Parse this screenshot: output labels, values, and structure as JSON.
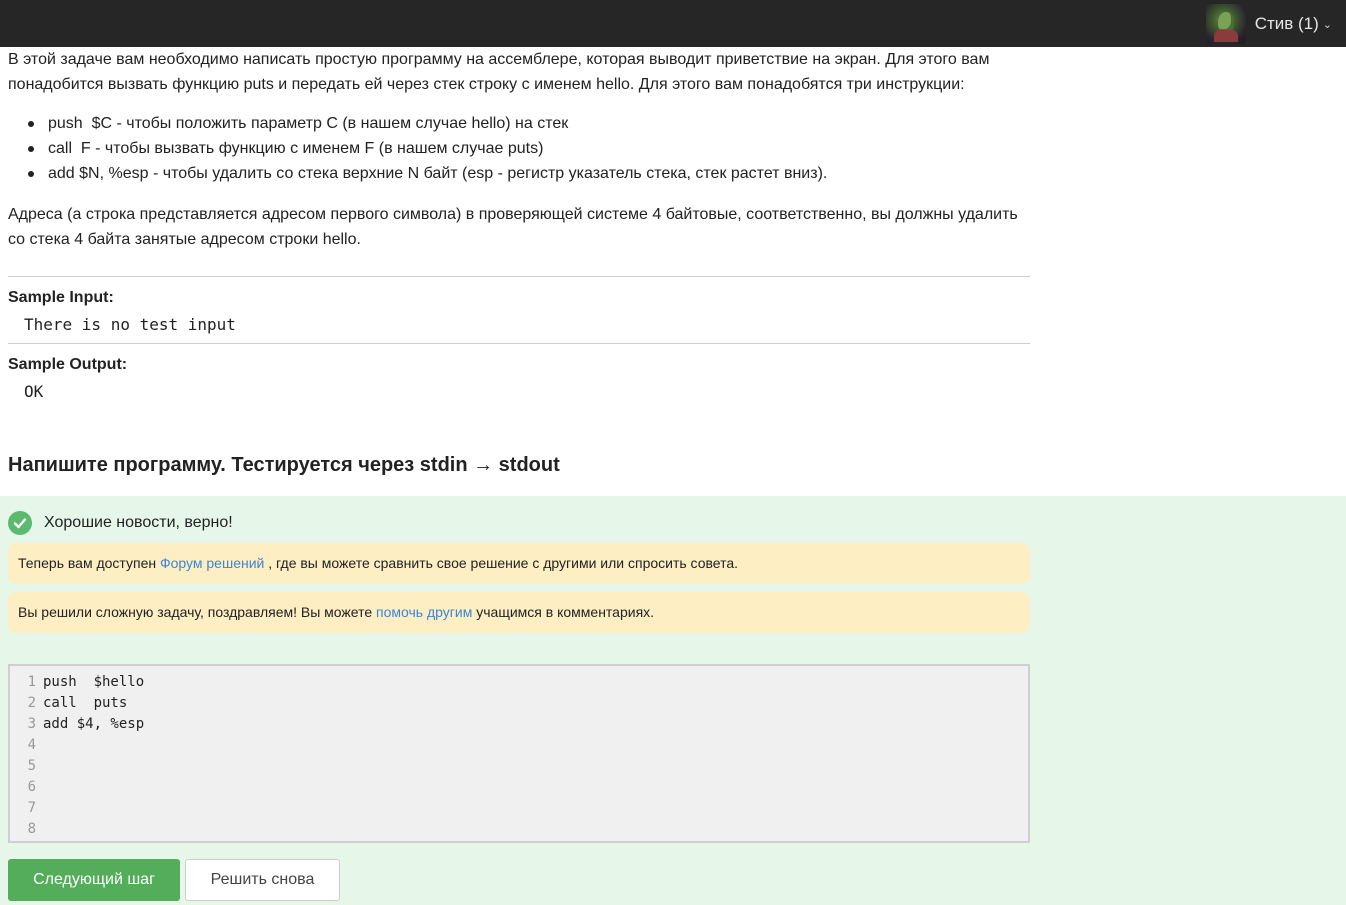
{
  "header": {
    "user_name": "Стив (1)",
    "chevron": "⌄"
  },
  "problem": {
    "intro": "В этой задаче вам необходимо написать простую программу на ассемблере, которая выводит приветствие на экран. Для этого вам понадобится вызвать функцию puts и передать ей через стек строку с именем hello. Для этого вам понадобятся три инструкции:",
    "bullets": [
      "push  $C - чтобы положить параметр C (в нашем случае hello) на стек",
      "call  F - чтобы вызвать функцию с именем F (в нашем случае puts)",
      "add $N, %esp - чтобы удалить со стека верхние N байт (esp - регистр указатель стека, стек растет вниз)."
    ],
    "note": "Адреса (а строка представляется адресом первого символа) в проверяющей системе 4 байтовые, соответственно, вы должны удалить со стека 4 байта занятые адресом строки hello."
  },
  "samples": {
    "input_label": "Sample Input:",
    "input_value": "There is no test input",
    "output_label": "Sample Output:",
    "output_value": "OK"
  },
  "task_heading": "Напишите программу. Тестируется через stdin → stdout",
  "result": {
    "success_text": "Хорошие новости, верно!",
    "notice1_before": "Теперь вам доступен ",
    "notice1_link": "Форум решений",
    "notice1_after": " , где вы можете сравнить свое решение с другими или спросить совета.",
    "notice2_before": "Вы решили сложную задачу, поздравляем! Вы можете ",
    "notice2_link": "помочь другим",
    "notice2_after": " учащимся в комментариях."
  },
  "editor": {
    "line_numbers": [
      "1",
      "2",
      "3",
      "4",
      "5",
      "6",
      "7",
      "8"
    ],
    "lines": [
      "push  $hello",
      "call  puts",
      "add $4, %esp",
      "",
      "",
      "",
      "",
      ""
    ]
  },
  "buttons": {
    "next_step": "Следующий шаг",
    "solve_again": "Решить снова"
  },
  "colors": {
    "topbar": "#262626",
    "success_zone": "#e6f7e9",
    "notice_bg": "#fdeec3",
    "link": "#3b86d6",
    "primary_button": "#54ad5b",
    "check": "#5bb970"
  }
}
